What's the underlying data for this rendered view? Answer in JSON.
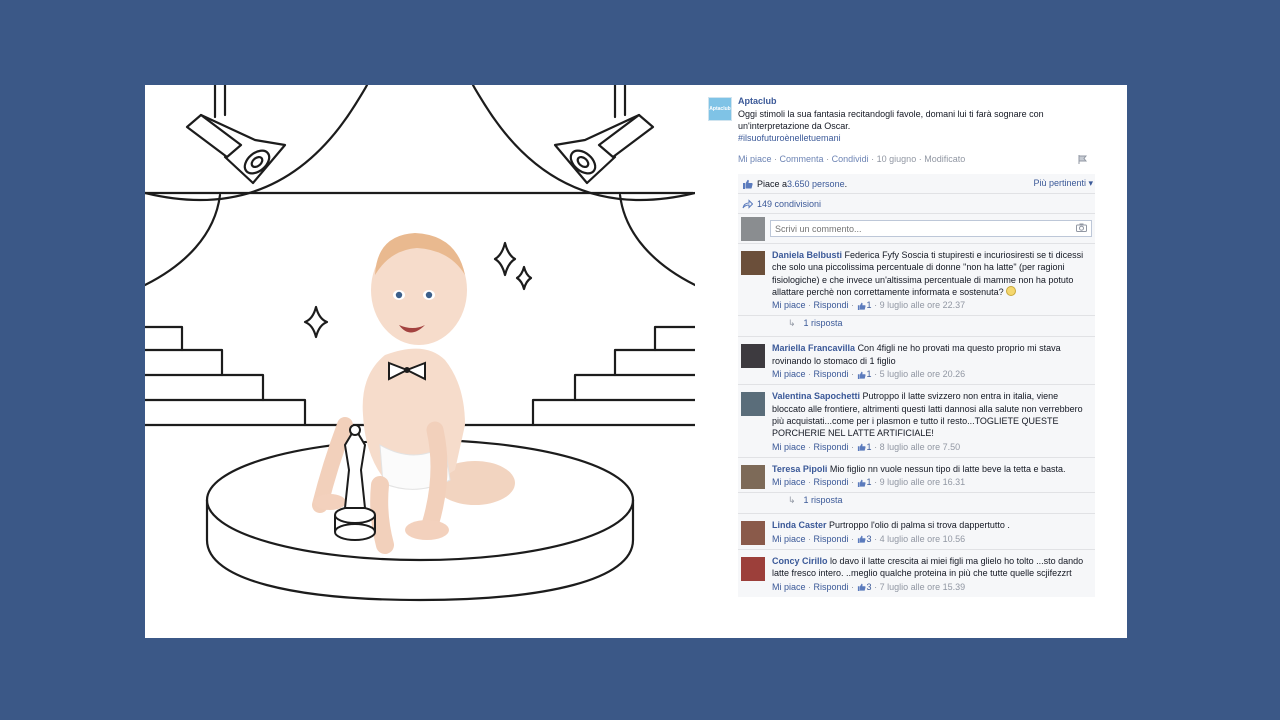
{
  "post": {
    "page_name": "Aptaclub",
    "avatar_label": "Aptaclub",
    "text": "Oggi stimoli la sua fantasia recitandogli favole, domani lui ti farà sognare con un'interpretazione da Oscar.",
    "hashtag": "#ilsuofuturoènelletuemani",
    "actions": {
      "like": "Mi piace",
      "comment": "Commenta",
      "share": "Condividi",
      "date": "10 giugno",
      "edited": "Modificato"
    }
  },
  "ufi": {
    "likes_prefix": "Piace a ",
    "likes_count": "3.650 persone",
    "likes_suffix": ".",
    "sort_label": "Più pertinenti ▾",
    "shares": "149 condivisioni",
    "comment_placeholder": "Scrivi un commento..."
  },
  "comment_actions": {
    "like": "Mi piace",
    "reply": "Rispondi"
  },
  "comments": [
    {
      "author": "Daniela Belbusti",
      "text": "Federica Fyfy Soscia ti stupiresti e incuriosiresti se ti dicessi che solo una piccolissima percentuale di donne \"non ha latte\" (per ragioni fisiologiche) e che invece un'altissima percentuale di mamme non ha potuto allattare perchè non correttamente informata e sostenuta?",
      "likes": "1",
      "date": "9 luglio alle ore 22.37",
      "replies": "1 risposta",
      "avatar_color": "#6b4f3a"
    },
    {
      "author": "Mariella Francavilla",
      "text": "Con 4figli ne ho provati ma questo proprio mi stava rovinando lo stomaco di 1 figlio",
      "likes": "1",
      "date": "5 luglio alle ore 20.26",
      "avatar_color": "#3d3a3f"
    },
    {
      "author": "Valentina Sapochetti",
      "text": "Putroppo il latte svizzero non entra in italia, viene bloccato alle frontiere, altrimenti questi latti dannosi alla salute non verrebbero più acquistati...come per i plasmon e tutto il resto...TOGLIETE QUESTE PORCHERIE NEL LATTE ARTIFICIALE!",
      "likes": "1",
      "date": "8 luglio alle ore 7.50",
      "avatar_color": "#5a6d7a"
    },
    {
      "author": "Teresa Pipoli",
      "text": "Mio figlio nn vuole nessun tipo di latte beve la tetta e basta.",
      "likes": "1",
      "date": "9 luglio alle ore 16.31",
      "replies": "1 risposta",
      "avatar_color": "#7d6a58"
    },
    {
      "author": "Linda Caster",
      "text": "Purtroppo l'olio di palma si trova dappertutto .",
      "likes": "3",
      "date": "4 luglio alle ore 10.56",
      "avatar_color": "#8a5a4a"
    },
    {
      "author": "Concy Cirillo",
      "text": "lo davo il latte crescita ai miei figli ma glielo ho tolto ...sto dando latte fresco intero. ..meglio qualche proteina in più che tutte quelle scjifezzrt",
      "likes": "3",
      "date": "7 luglio alle ore 15.39",
      "avatar_color": "#9c3f3a"
    }
  ]
}
